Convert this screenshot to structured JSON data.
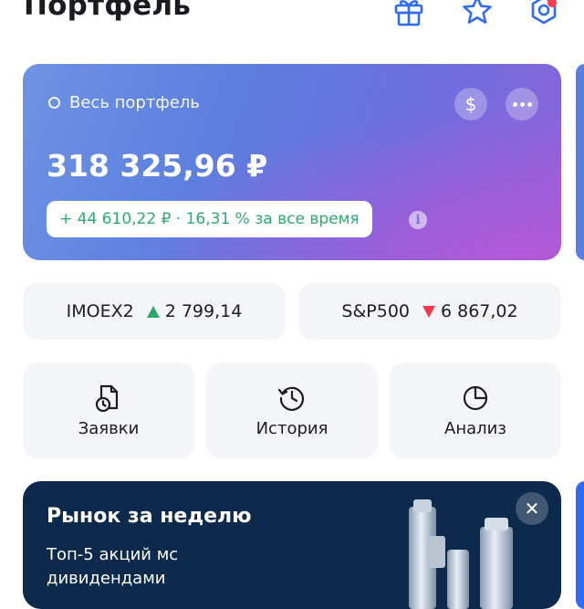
{
  "header": {
    "title": "Портфель",
    "icons": [
      "gift-icon",
      "star-icon",
      "settings-icon"
    ]
  },
  "portfolio": {
    "selector_label": "Весь портфель",
    "currency_button_symbol": "$",
    "total_value": "318 325,96 ₽",
    "change_text": "+ 44 610,22 ₽ · 16,31 % за все время",
    "info_symbol": "i",
    "colors": {
      "gradient_start": "#6e93e3",
      "gradient_end": "#8e63d9",
      "positive": "#2bab72"
    }
  },
  "indices": [
    {
      "name": "IMOEX2",
      "direction": "up",
      "value": "2 799,14"
    },
    {
      "name": "S&P500",
      "direction": "down",
      "value": "6 867,02"
    }
  ],
  "actions": [
    {
      "label": "Заявки",
      "icon": "orders-clock-icon"
    },
    {
      "label": "История",
      "icon": "history-icon"
    },
    {
      "label": "Анализ",
      "icon": "pie-chart-icon"
    }
  ],
  "market_banner": {
    "title": "Рынок за неделю",
    "subtitle": "Топ-5 акций мс дивидендами",
    "close_symbol": "✕"
  }
}
